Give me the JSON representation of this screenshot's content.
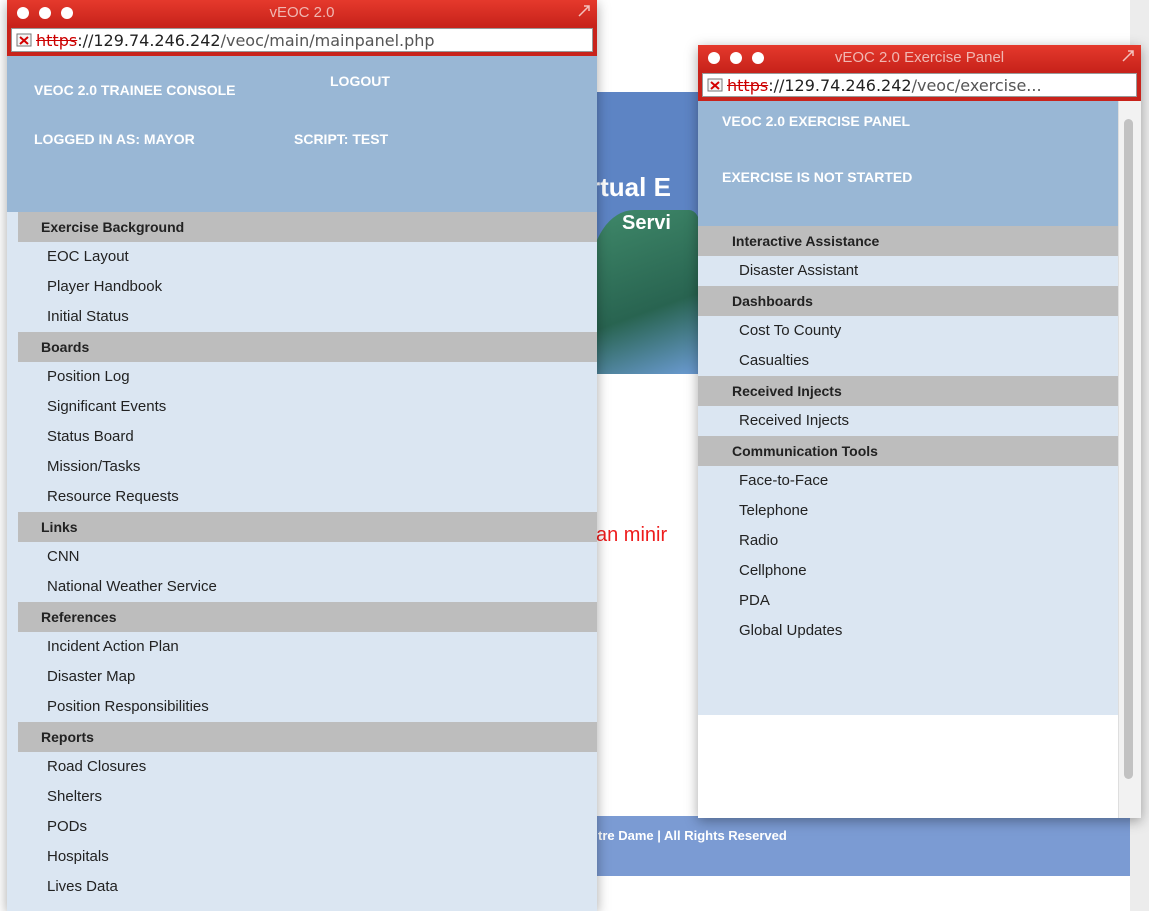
{
  "background_page": {
    "title_line1": "rtual E",
    "title_line2": "Servi",
    "red_text": "an minir",
    "footer": "tre Dame | All Rights Reserved"
  },
  "main_window": {
    "title": "vEOC 2.0",
    "url_protocol": "https",
    "url_host": "://129.74.246.242",
    "url_path": "/veoc/main/mainpanel.php",
    "console_title": "VEOC 2.0 TRAINEE CONSOLE",
    "logout_label": "LOGOUT",
    "logged_in": "LOGGED IN AS: MAYOR",
    "script": "SCRIPT: TEST",
    "sections": [
      {
        "heading": "Exercise Background",
        "items": [
          "EOC Layout",
          "Player Handbook",
          "Initial Status"
        ]
      },
      {
        "heading": "Boards",
        "items": [
          "Position Log",
          "Significant Events",
          "Status Board",
          "Mission/Tasks",
          "Resource Requests"
        ]
      },
      {
        "heading": "Links",
        "items": [
          "CNN",
          "National Weather Service"
        ]
      },
      {
        "heading": "References",
        "items": [
          "Incident Action Plan",
          "Disaster Map",
          "Position Responsibilities"
        ]
      },
      {
        "heading": "Reports",
        "items": [
          "Road Closures",
          "Shelters",
          "PODs",
          "Hospitals",
          "Lives Data"
        ]
      }
    ]
  },
  "exercise_window": {
    "title": "vEOC 2.0 Exercise Panel",
    "url_protocol": "https",
    "url_host": "://129.74.246.242",
    "url_path": "/veoc/exercise...",
    "panel_title": "VEOC 2.0 EXERCISE PANEL",
    "status": "EXERCISE IS NOT STARTED",
    "sections": [
      {
        "heading": "Interactive Assistance",
        "items": [
          "Disaster Assistant"
        ]
      },
      {
        "heading": "Dashboards",
        "items": [
          "Cost To County",
          "Casualties"
        ]
      },
      {
        "heading": "Received Injects",
        "items": [
          "Received Injects"
        ]
      },
      {
        "heading": "Communication Tools",
        "items": [
          "Face-to-Face",
          "Telephone",
          "Radio",
          "Cellphone",
          "PDA",
          "Global Updates"
        ]
      }
    ]
  },
  "colors": {
    "titlebar": "#d22a20",
    "header_bg": "#99b7d5",
    "menu_bg": "#dbe6f2",
    "section_bg": "#bdbdbd"
  }
}
